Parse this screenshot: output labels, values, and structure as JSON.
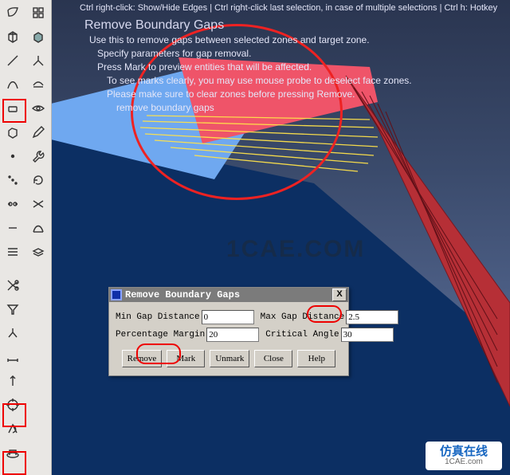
{
  "hint_bar": "Ctrl right-click: Show/Hide Edges | Ctrl right-click last selection, in case of multiple selections | Ctrl h: Hotkey",
  "title": "Remove Boundary Gaps",
  "instructions": [
    "Use this to remove gaps between selected zones and target zone.",
    "Specify parameters for gap removal.",
    "Press Mark to preview entities that will be affected.",
    "To see marks clearly, you may use mouse probe to deselect face zones.",
    "Please make sure to clear zones before pressing Remove.",
    "remove boundary gaps"
  ],
  "watermark": "1CAE.COM",
  "wm2": "仿真在线",
  "wm2_sub": "1CAE.com",
  "dialog": {
    "title": "Remove Boundary Gaps",
    "close": "X",
    "fields": {
      "min_gap_label": "Min Gap Distance",
      "min_gap_value": "0",
      "max_gap_label": "Max Gap Distance",
      "max_gap_value": "2.5",
      "pct_label": "Percentage Margin",
      "pct_value": "20",
      "crit_label": "Critical Angle",
      "crit_value": "30"
    },
    "buttons": {
      "remove": "Remove",
      "mark": "Mark",
      "unmark": "Unmark",
      "close": "Close",
      "help": "Help"
    }
  },
  "colors": {
    "accent_red": "#e00",
    "window_gray": "#d4d0c8"
  },
  "tools_left": [
    "patch-icon",
    "cube-icon",
    "line-icon",
    "curve-icon",
    "quad-icon",
    "box-icon",
    "point-icon",
    "noop-icon",
    "eye-icon",
    "rule-icon",
    "chain-icon",
    "trim-icon",
    "dim-icon",
    "probe-icon",
    "target-icon",
    "orient-icon",
    "base-icon"
  ],
  "tools_right": [
    "views-icon",
    "solid-icon",
    "axis-icon",
    "shade-icon",
    "eye2-icon",
    "pencil-icon",
    "wrench-icon",
    "loop-icon",
    "merge-icon",
    "sweep-icon",
    "layer-icon"
  ]
}
